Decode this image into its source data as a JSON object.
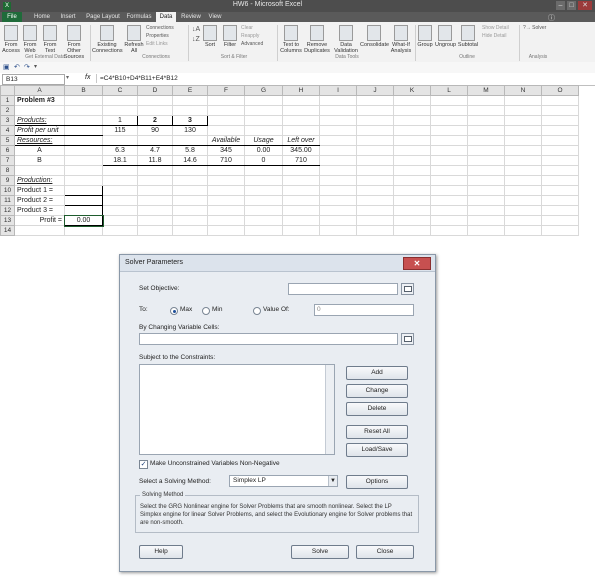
{
  "excel": {
    "window_title": "HW6 - Microsoft Excel",
    "tabs": [
      "File",
      "Home",
      "Insert",
      "Page Layout",
      "Formulas",
      "Data",
      "Review",
      "View"
    ],
    "active_tab": "Data",
    "ribbon": {
      "from_access": "From Access",
      "from_web": "From Web",
      "from_text": "From Text",
      "from_other": "From Other Sources",
      "existing_connections": "Existing Connections",
      "refresh_all": "Refresh All",
      "connections": "Connections",
      "properties": "Properties",
      "edit_links": "Edit Links",
      "sort": "Sort",
      "filter": "Filter",
      "clear": "Clear",
      "reapply": "Reapply",
      "advanced": "Advanced",
      "text_to_columns": "Text to Columns",
      "remove_duplicates": "Remove Duplicates",
      "data_validation": "Data Validation",
      "consolidate": "Consolidate",
      "whatif": "What-If Analysis",
      "group": "Group",
      "ungroup": "Ungroup",
      "subtotal": "Subtotal",
      "show_detail": "Show Detail",
      "hide_detail": "Hide Detail",
      "solver": "Solver",
      "group_labels": {
        "get_external": "Get External Data",
        "connections": "Connections",
        "sort_filter": "Sort & Filter",
        "data_tools": "Data Tools",
        "outline": "Outline",
        "analysis": "Analysis"
      }
    },
    "name_box": "B13",
    "formula": "=C4*B10+D4*B11+E4*B12",
    "columns": [
      "A",
      "B",
      "C",
      "D",
      "E",
      "F",
      "G",
      "H",
      "I",
      "J",
      "K",
      "L",
      "M",
      "N",
      "O"
    ],
    "rows": {
      "1": {
        "A": "Problem #3"
      },
      "3": {
        "A": "Products:",
        "C": "1",
        "D": "2",
        "E": "3"
      },
      "4": {
        "A": "Profit per unit",
        "C": "115",
        "D": "90",
        "E": "130"
      },
      "5": {
        "A": "Resources:",
        "F": "Available",
        "G": "Usage",
        "H": "Left over"
      },
      "6": {
        "A": "A",
        "C": "6.3",
        "D": "4.7",
        "E": "5.8",
        "F": "345",
        "G": "0.00",
        "H": "345.00"
      },
      "7": {
        "A": "B",
        "C": "18.1",
        "D": "11.8",
        "E": "14.6",
        "F": "710",
        "G": "0",
        "H": "710"
      },
      "9": {
        "A": "Production:"
      },
      "10": {
        "A": "Product 1 ="
      },
      "11": {
        "A": "Product 2 ="
      },
      "12": {
        "A": "Product 3 ="
      },
      "13": {
        "A": "Profit =",
        "B": "0.00"
      }
    }
  },
  "solver": {
    "title": "Solver Parameters",
    "set_objective_label": "Set Objective:",
    "set_objective_value": "",
    "to_label": "To:",
    "max_label": "Max",
    "min_label": "Min",
    "value_of_label": "Value Of:",
    "value_of_value": "0",
    "changing_label": "By Changing Variable Cells:",
    "changing_value": "",
    "constraints_label": "Subject to the Constraints:",
    "add_button": "Add",
    "change_button": "Change",
    "delete_button": "Delete",
    "reset_button": "Reset All",
    "loadsave_button": "Load/Save",
    "nonneg_label": "Make Unconstrained Variables Non-Negative",
    "nonneg_checked": true,
    "method_label": "Select a Solving Method:",
    "method_value": "Simplex LP",
    "options_button": "Options",
    "solving_method_heading": "Solving Method",
    "solving_method_text": "Select the GRG Nonlinear engine for Solver Problems that are smooth nonlinear. Select the LP Simplex engine for linear Solver Problems, and select the Evolutionary engine for Solver problems that are non-smooth.",
    "help_button": "Help",
    "solve_button": "Solve",
    "close_button": "Close"
  }
}
